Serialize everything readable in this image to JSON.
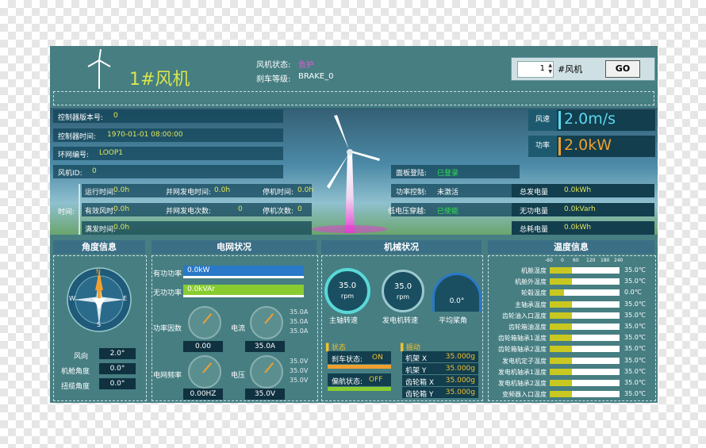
{
  "header": {
    "title": "1#风机",
    "status_label": "风机状态:",
    "status_value": "告护",
    "brake_label": "刹车等级:",
    "brake_value": "BRAKE_0",
    "selector_value": "1",
    "selector_suffix": "#风机",
    "go_label": "GO"
  },
  "info": {
    "version_label": "控制器版本号:",
    "version_value": "0",
    "time_label": "控制器时间:",
    "time_value": "1970-01-01 08:00:00",
    "ring_label": "环网编号:",
    "ring_value": "LOOP1",
    "id_label": "风机ID:",
    "id_value": "0",
    "time_group_label": "时间:",
    "run_time_label": "运行时间:",
    "run_time_value": "0.0h",
    "grid_time_label": "并网发电时间:",
    "grid_time_value": "0.0h",
    "stop_time_label": "停机时间:",
    "stop_time_value": "0.0h",
    "wind_time_label": "有效风时:",
    "wind_time_value": "0.0h",
    "grid_count_label": "并网发电次数:",
    "grid_count_value": "0",
    "stop_count_label": "停机次数:",
    "stop_count_value": "0",
    "full_time_label": "满发时间:",
    "full_time_value": "0.0h",
    "panel_login_label": "面板登陆:",
    "panel_login_value": "已登录",
    "power_ctrl_label": "功率控制:",
    "power_ctrl_value": "未激活",
    "lvrt_label": "低电压穿越:",
    "lvrt_value": "已使能"
  },
  "metrics": {
    "wind_label": "风速",
    "wind_value": "2.0m/s",
    "power_label": "功率",
    "power_value": "2.0kW",
    "total_gen_label": "总发电量",
    "total_gen_value": "0.0kWh",
    "reactive_label": "无功电量",
    "reactive_value": "0.0kVarh",
    "consumption_label": "总耗电量",
    "consumption_value": "0.0kWh"
  },
  "angle": {
    "title": "角度信息",
    "compass": {
      "n": "N",
      "s": "S",
      "e": "E",
      "w": "W"
    },
    "wind_dir_label": "风向",
    "wind_dir_value": "2.0°",
    "nacelle_label": "机舱角度",
    "nacelle_value": "0.0°",
    "twist_label": "扭缆角度",
    "twist_value": "0.0°"
  },
  "grid": {
    "title": "电网状况",
    "active_label": "有功功率",
    "active_value": "0.0kW",
    "reactive_label": "无功功率",
    "reactive_value": "0.0kVAr",
    "pf_label": "功率因数",
    "pf_value": "0.00",
    "current_label": "电流",
    "current_value": "35.0A",
    "current_phases": [
      "35.0A",
      "35.0A",
      "35.0A"
    ],
    "freq_label": "电网频率",
    "freq_value": "0.00HZ",
    "voltage_label": "电压",
    "voltage_value": "35.0V",
    "voltage_phases": [
      "35.0V",
      "35.0V",
      "35.0V"
    ]
  },
  "mech": {
    "title": "机械状况",
    "main_rpm": "35.0",
    "main_unit": "rpm",
    "main_label": "主轴转速",
    "gen_rpm": "35.0",
    "gen_unit": "rpm",
    "gen_label": "发电机转速",
    "pitch_value": "0.0°",
    "pitch_label": "平均桨角",
    "state_title": "状态",
    "vib_title": "振动",
    "brake_state_label": "刹车状态:",
    "brake_state_value": "ON",
    "yaw_state_label": "偏航状态:",
    "yaw_state_value": "OFF",
    "vib_rows": [
      {
        "label": "机架 X",
        "value": "35.000g"
      },
      {
        "label": "机架 Y",
        "value": "35.000g"
      },
      {
        "label": "齿轮箱 X",
        "value": "35.000g"
      },
      {
        "label": "齿轮箱 Y",
        "value": "35.000g"
      }
    ]
  },
  "temp": {
    "title": "温度信息",
    "scale": [
      "-60",
      "0",
      "60",
      "120",
      "180",
      "240"
    ],
    "rows": [
      {
        "label": "机舱温度",
        "value": "35.0℃",
        "level": 0.32
      },
      {
        "label": "机舱外温度",
        "value": "35.0℃",
        "level": 0.32
      },
      {
        "label": "轮毂温度",
        "value": "0.0℃",
        "level": 0.2
      },
      {
        "label": "主轴承温度",
        "value": "35.0℃",
        "level": 0.32
      },
      {
        "label": "齿轮油入口温度",
        "value": "35.0℃",
        "level": 0.32
      },
      {
        "label": "齿轮箱油温度",
        "value": "35.0℃",
        "level": 0.32
      },
      {
        "label": "齿轮箱轴承1温度",
        "value": "35.0℃",
        "level": 0.32
      },
      {
        "label": "齿轮箱轴承2温度",
        "value": "35.0℃",
        "level": 0.32
      },
      {
        "label": "发电机定子温度",
        "value": "35.0℃",
        "level": 0.32
      },
      {
        "label": "发电机轴承1温度",
        "value": "35.0℃",
        "level": 0.32
      },
      {
        "label": "发电机轴承2温度",
        "value": "35.0℃",
        "level": 0.32
      },
      {
        "label": "变频器入口温度",
        "value": "35.0℃",
        "level": 0.32
      }
    ]
  }
}
